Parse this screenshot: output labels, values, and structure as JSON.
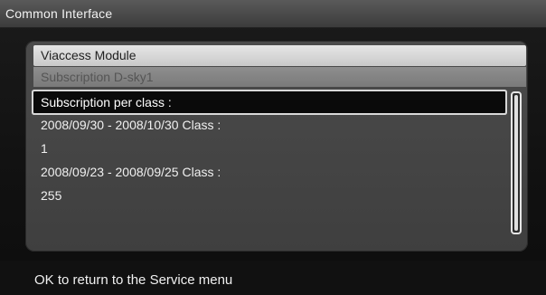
{
  "window": {
    "title": "Common Interface"
  },
  "module": {
    "header": "Viaccess Module",
    "subheader": "Subscription D-sky1"
  },
  "list": {
    "items": [
      "Subscription per class :",
      "2008/09/30 - 2008/10/30 Class :",
      "1",
      "2008/09/23 - 2008/09/25 Class :",
      "255"
    ],
    "selected_index": 0
  },
  "footer": {
    "hint": "OK to return to the Service menu"
  }
}
